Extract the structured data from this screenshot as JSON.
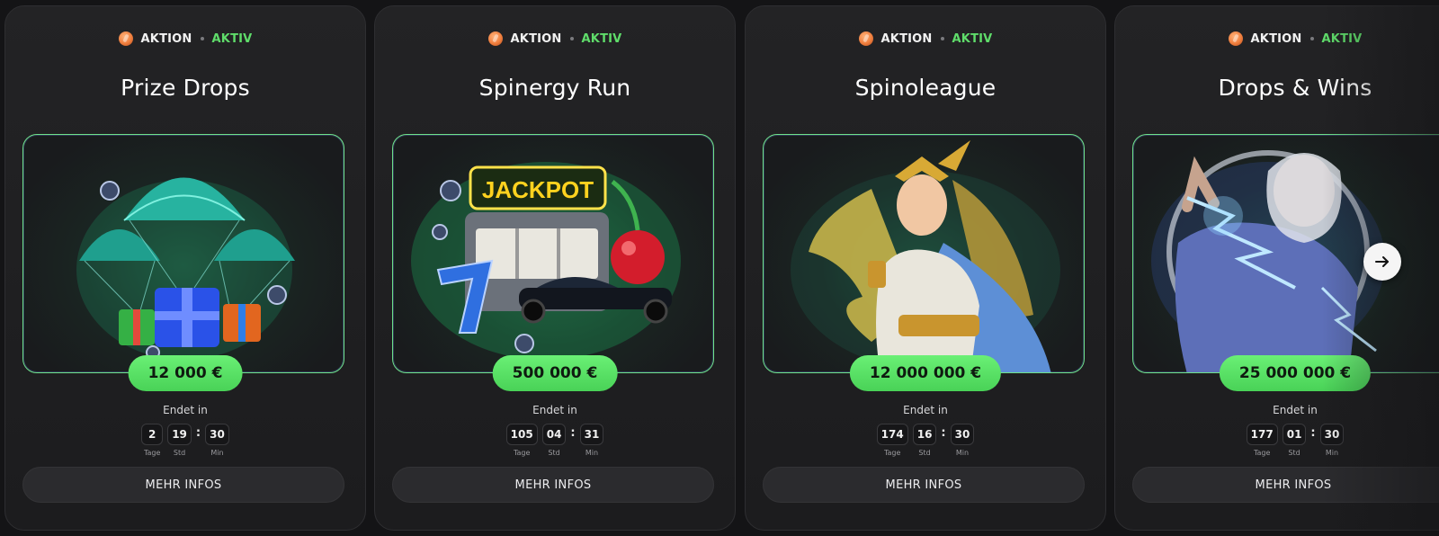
{
  "colors": {
    "accent_green": "#5fdc6a",
    "prize_green": "#55dd62",
    "card_bg": "#1f1f21",
    "page_bg": "#141416"
  },
  "cards": [
    {
      "badge": "AKTION",
      "status": "AKTIV",
      "title": "Prize Drops",
      "image": "prize-drops-parachute-gifts",
      "prize": "12 000 €",
      "ends_label": "Endet in",
      "timer": [
        {
          "value": "2",
          "label": "Tage"
        },
        {
          "value": "19",
          "label": "Std"
        },
        {
          "value": "30",
          "label": "Min"
        }
      ],
      "button": "MEHR INFOS"
    },
    {
      "badge": "AKTION",
      "status": "AKTIV",
      "title": "Spinergy Run",
      "image": "jackpot-slot-machine-race-car",
      "image_text": "JACKPOT",
      "prize": "500 000 €",
      "ends_label": "Endet in",
      "timer": [
        {
          "value": "105",
          "label": "Tage"
        },
        {
          "value": "04",
          "label": "Std"
        },
        {
          "value": "31",
          "label": "Min"
        }
      ],
      "button": "MEHR INFOS"
    },
    {
      "badge": "AKTION",
      "status": "AKTIV",
      "title": "Spinoleague",
      "image": "golden-goddess",
      "prize": "12 000 000 €",
      "ends_label": "Endet in",
      "timer": [
        {
          "value": "174",
          "label": "Tage"
        },
        {
          "value": "16",
          "label": "Std"
        },
        {
          "value": "30",
          "label": "Min"
        }
      ],
      "button": "MEHR INFOS"
    },
    {
      "badge": "AKTION",
      "status": "AKTIV",
      "title": "Drops & Wins",
      "image": "zeus-lightning",
      "prize": "25 000 000 €",
      "ends_label": "Endet in",
      "timer": [
        {
          "value": "177",
          "label": "Tage"
        },
        {
          "value": "01",
          "label": "Std"
        },
        {
          "value": "30",
          "label": "Min"
        }
      ],
      "button": "MEHR INFOS"
    }
  ],
  "nav": {
    "next_icon": "arrow-right-icon"
  }
}
